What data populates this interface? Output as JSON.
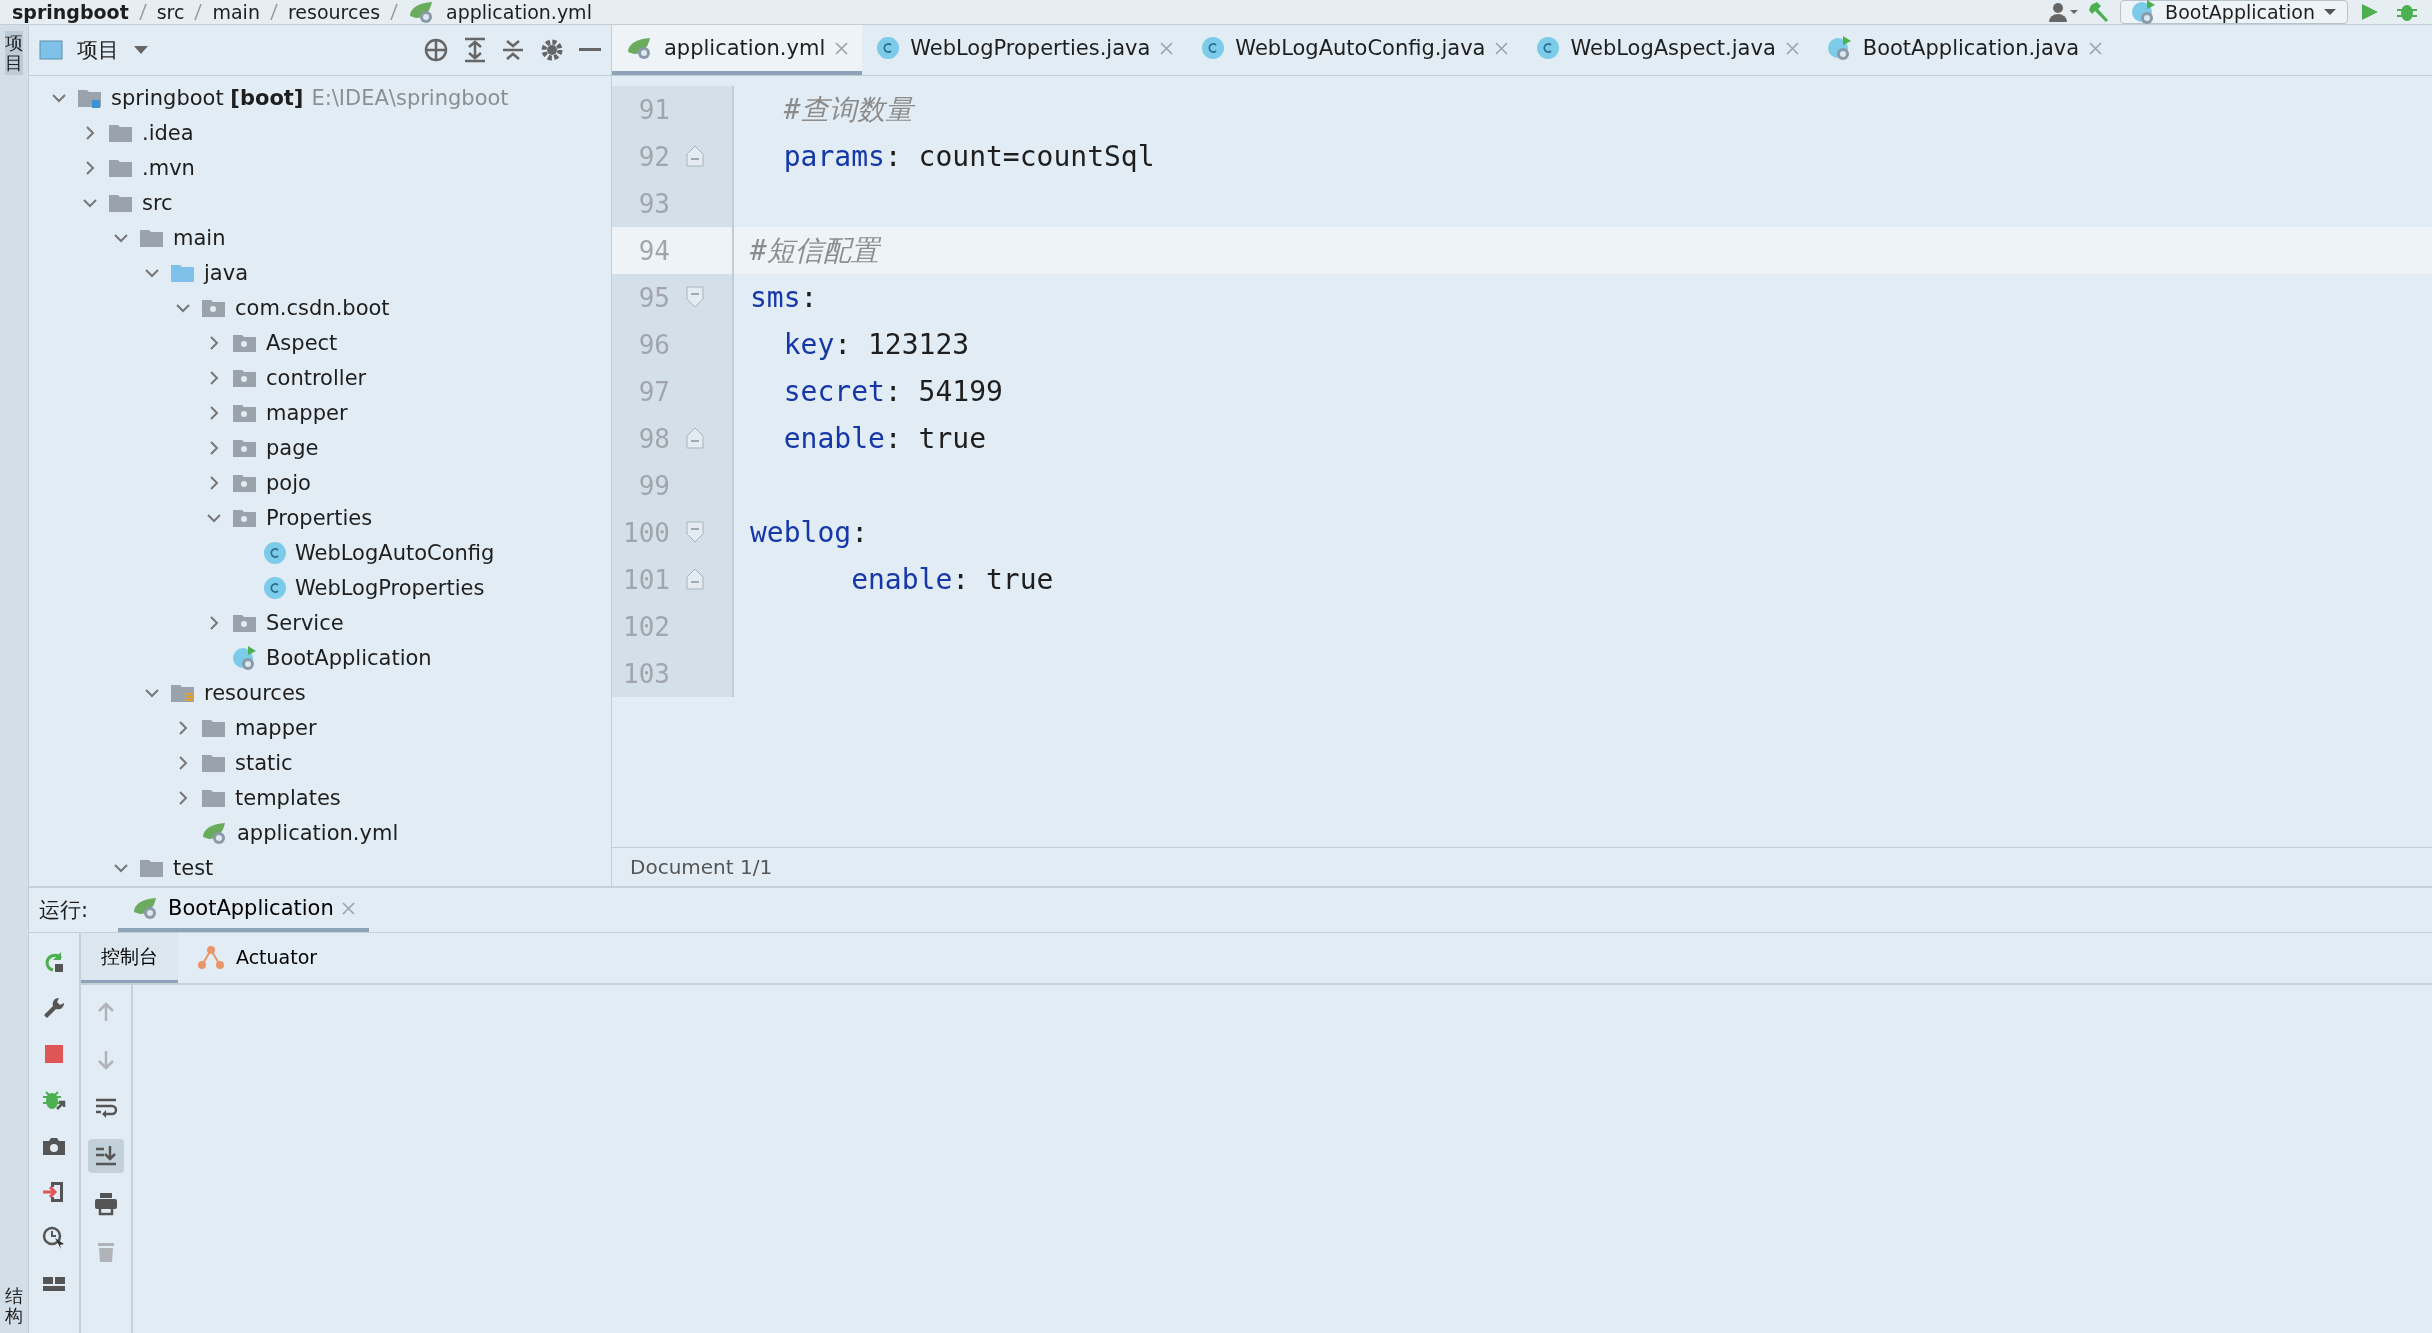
{
  "breadcrumb": [
    "springboot",
    "src",
    "main",
    "resources",
    "application.yml"
  ],
  "run_config": "BootApplication",
  "left_strip": {
    "top": "项目",
    "bottom": "结构"
  },
  "project_panel": {
    "title": "项目",
    "tree": [
      {
        "label": "springboot **[boot]**",
        "path": "E:\\IDEA\\springboot",
        "kind": "module",
        "expanded": true,
        "children": [
          {
            "label": ".idea",
            "kind": "folder",
            "expanded": false
          },
          {
            "label": ".mvn",
            "kind": "folder",
            "expanded": false
          },
          {
            "label": "src",
            "kind": "folder",
            "expanded": true,
            "children": [
              {
                "label": "main",
                "kind": "folder",
                "expanded": true,
                "children": [
                  {
                    "label": "java",
                    "kind": "source-folder",
                    "expanded": true,
                    "children": [
                      {
                        "label": "com.csdn.boot",
                        "kind": "package",
                        "expanded": true,
                        "children": [
                          {
                            "label": "Aspect",
                            "kind": "package",
                            "expanded": false
                          },
                          {
                            "label": "controller",
                            "kind": "package",
                            "expanded": false
                          },
                          {
                            "label": "mapper",
                            "kind": "package",
                            "expanded": false
                          },
                          {
                            "label": "page",
                            "kind": "package",
                            "expanded": false
                          },
                          {
                            "label": "pojo",
                            "kind": "package",
                            "expanded": false
                          },
                          {
                            "label": "Properties",
                            "kind": "package",
                            "expanded": true,
                            "children": [
                              {
                                "label": "WebLogAutoConfig",
                                "kind": "class"
                              },
                              {
                                "label": "WebLogProperties",
                                "kind": "class"
                              }
                            ]
                          },
                          {
                            "label": "Service",
                            "kind": "package",
                            "expanded": false
                          },
                          {
                            "label": "BootApplication",
                            "kind": "spring-class"
                          }
                        ]
                      }
                    ]
                  },
                  {
                    "label": "resources",
                    "kind": "resources",
                    "expanded": true,
                    "children": [
                      {
                        "label": "mapper",
                        "kind": "folder",
                        "expanded": false
                      },
                      {
                        "label": "static",
                        "kind": "folder",
                        "expanded": false
                      },
                      {
                        "label": "templates",
                        "kind": "folder",
                        "expanded": false
                      },
                      {
                        "label": "application.yml",
                        "kind": "yaml"
                      }
                    ]
                  }
                ]
              },
              {
                "label": "test",
                "kind": "folder",
                "expanded": true
              }
            ]
          }
        ]
      }
    ]
  },
  "editor_tabs": [
    {
      "label": "application.yml",
      "kind": "yaml",
      "selected": true
    },
    {
      "label": "WebLogProperties.java",
      "kind": "class",
      "selected": false
    },
    {
      "label": "WebLogAutoConfig.java",
      "kind": "class",
      "selected": false
    },
    {
      "label": "WebLogAspect.java",
      "kind": "class",
      "selected": false
    },
    {
      "label": "BootApplication.java",
      "kind": "spring-class",
      "selected": false
    }
  ],
  "editor": {
    "lines": [
      {
        "number": "91",
        "kind": "plain",
        "current": false,
        "parts": [
          {
            "kind": "comment",
            "text": "  #查询数量"
          }
        ]
      },
      {
        "number": "92",
        "kind": "fold-end",
        "current": false,
        "parts": [
          {
            "kind": "key",
            "text": "  params"
          },
          {
            "kind": "punct",
            "text": ": "
          },
          {
            "kind": "value",
            "text": "count=countSql"
          }
        ]
      },
      {
        "number": "93",
        "kind": "plain",
        "current": false
      },
      {
        "number": "94",
        "kind": "plain",
        "current": true,
        "parts": [
          {
            "kind": "comment",
            "text": "#短信配置"
          }
        ]
      },
      {
        "number": "95",
        "kind": "fold-start",
        "current": false,
        "parts": [
          {
            "kind": "key",
            "text": "sms"
          },
          {
            "kind": "punct",
            "text": ":"
          }
        ]
      },
      {
        "number": "96",
        "kind": "plain",
        "current": false,
        "parts": [
          {
            "kind": "key",
            "text": "  key"
          },
          {
            "kind": "punct",
            "text": ": "
          },
          {
            "kind": "value",
            "text": "123123"
          }
        ]
      },
      {
        "number": "97",
        "kind": "plain",
        "current": false,
        "parts": [
          {
            "kind": "key",
            "text": "  secret"
          },
          {
            "kind": "punct",
            "text": ": "
          },
          {
            "kind": "value",
            "text": "54199"
          }
        ]
      },
      {
        "number": "98",
        "kind": "fold-end",
        "current": false,
        "parts": [
          {
            "kind": "key",
            "text": "  enable"
          },
          {
            "kind": "punct",
            "text": ": "
          },
          {
            "kind": "value",
            "text": "true"
          }
        ]
      },
      {
        "number": "99",
        "kind": "plain",
        "current": false
      },
      {
        "number": "100",
        "kind": "fold-start",
        "current": false,
        "parts": [
          {
            "kind": "key",
            "text": "weblog"
          },
          {
            "kind": "punct",
            "text": ":"
          }
        ]
      },
      {
        "number": "101",
        "kind": "fold-end",
        "current": false,
        "parts": [
          {
            "kind": "key",
            "text": "      enable"
          },
          {
            "kind": "punct",
            "text": ": "
          },
          {
            "kind": "value",
            "text": "true"
          }
        ]
      },
      {
        "number": "102",
        "kind": "plain",
        "current": false
      },
      {
        "number": "103",
        "kind": "plain",
        "current": false
      }
    ],
    "status": "Document 1/1"
  },
  "run_panel": {
    "label": "运行:",
    "tab": "BootApplication",
    "subtabs": [
      {
        "label": "控制台",
        "kind": "console",
        "selected": true
      },
      {
        "label": "Actuator",
        "kind": "actuator",
        "selected": false
      }
    ],
    "run_tools": [
      {
        "kind": "rerun"
      },
      {
        "kind": "wrench"
      },
      {
        "kind": "stop"
      },
      {
        "kind": "debug"
      },
      {
        "kind": "camera"
      },
      {
        "kind": "import"
      },
      {
        "kind": "profile"
      },
      {
        "kind": "layout"
      }
    ],
    "console_tools": [
      {
        "kind": "up",
        "disabled": true,
        "selected": false
      },
      {
        "kind": "down",
        "disabled": true,
        "selected": false
      },
      {
        "kind": "wrap",
        "disabled": false,
        "selected": false
      },
      {
        "kind": "scroll-end",
        "disabled": false,
        "selected": true
      },
      {
        "kind": "print",
        "disabled": false,
        "selected": false
      },
      {
        "kind": "trash",
        "disabled": true,
        "selected": false
      }
    ]
  }
}
